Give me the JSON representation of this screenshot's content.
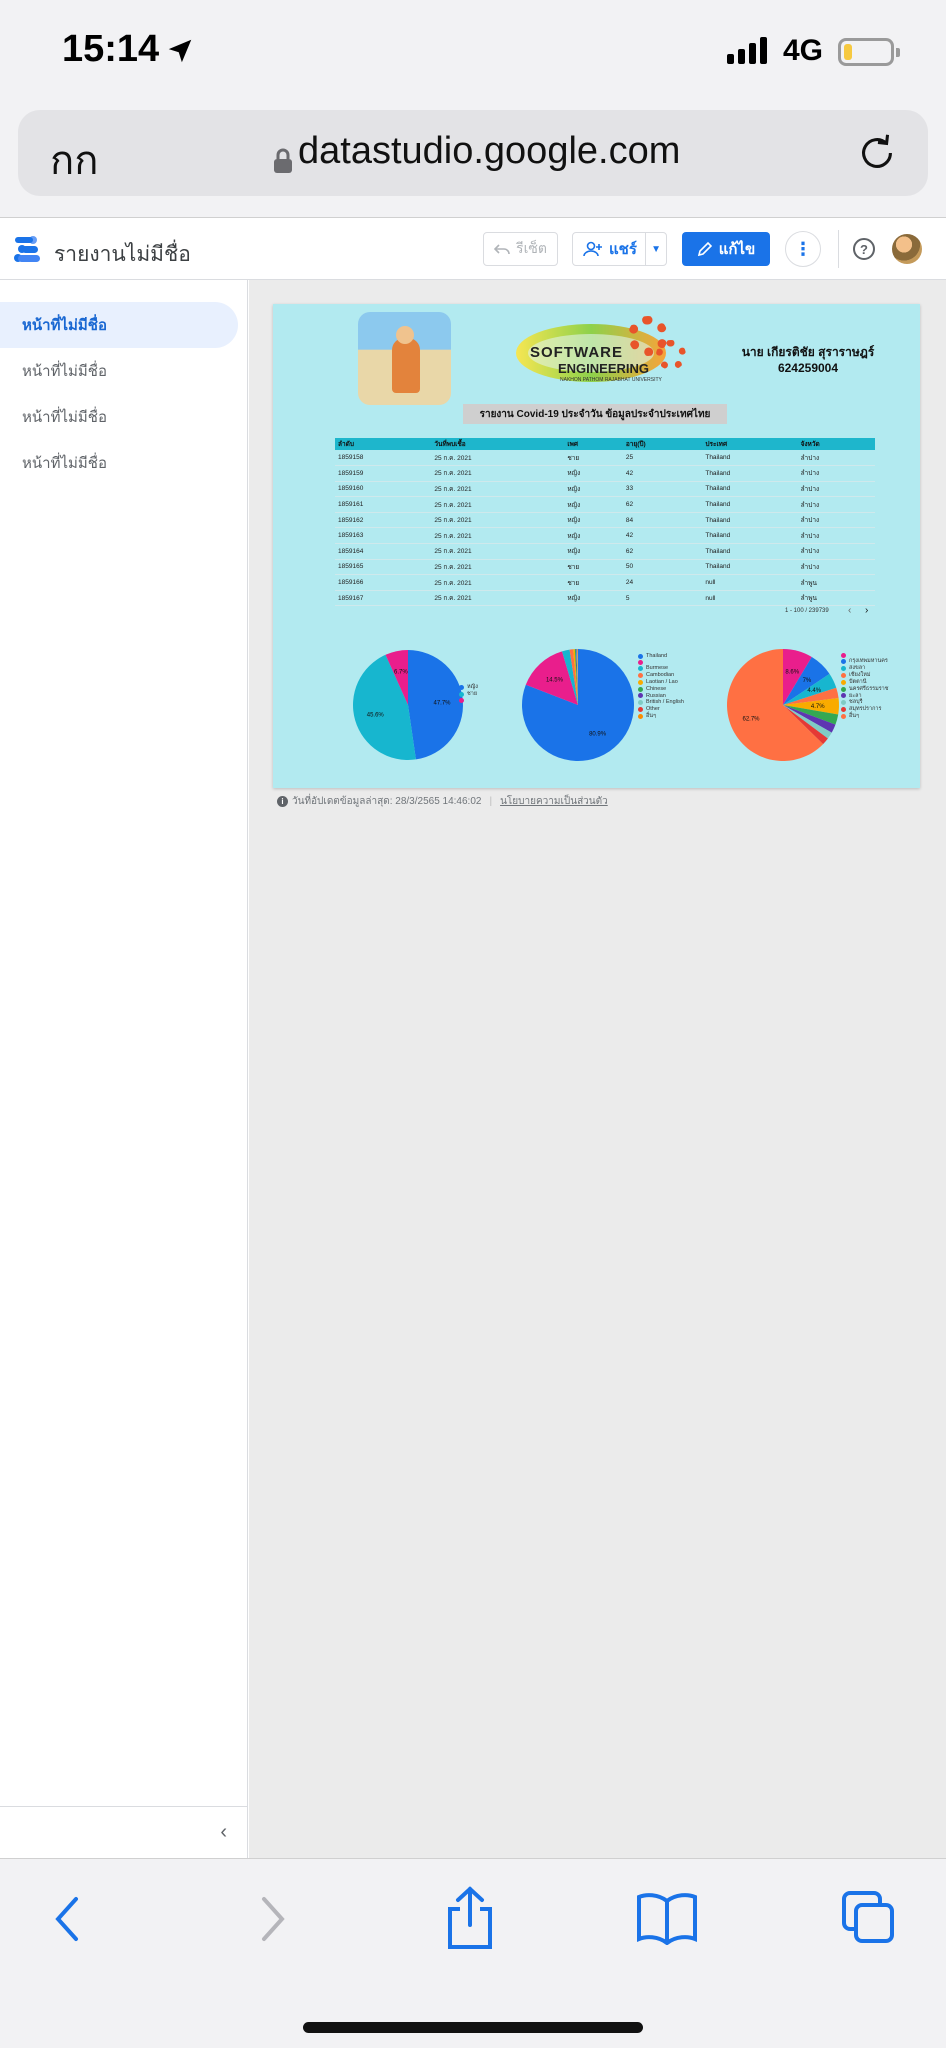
{
  "status_bar": {
    "time": "15:14",
    "network": "4G",
    "battery_level": 0.18
  },
  "safari": {
    "aa_label": "กก",
    "url": "datastudio.google.com"
  },
  "header": {
    "report_title": "รายงานไม่มีชื่อ",
    "reset_label": "รีเซ็ต",
    "share_label": "แชร์",
    "edit_label": "แก้ไข"
  },
  "sidebar": {
    "pages": [
      {
        "label": "หน้าที่ไม่มีชื่อ",
        "active": true
      },
      {
        "label": "หน้าที่ไม่มีชื่อ",
        "active": false
      },
      {
        "label": "หน้าที่ไม่มีชื่อ",
        "active": false
      },
      {
        "label": "หน้าที่ไม่มีชื่อ",
        "active": false
      }
    ]
  },
  "report": {
    "logo_line1": "SOFTWARE",
    "logo_line2": "ENGINEERING",
    "logo_line3": "NAKHON PATHOM RAJABHAT UNIVERSITY",
    "author_name": "นาย เกียรติชัย สุราราษฎร์",
    "author_id": "624259004",
    "title": "รายงาน Covid-19 ประจำวัน ข้อมูลประจำประเทศไทย",
    "table": {
      "columns": [
        "ลำดับ",
        "วันที่พบเชื้อ",
        "เพศ",
        "อายุ(ปี)",
        "ประเทศ",
        "จังหวัด"
      ],
      "rows": [
        [
          "1859158",
          "25 ก.ค. 2021",
          "ชาย",
          "25",
          "Thailand",
          "ลำปาง"
        ],
        [
          "1859159",
          "25 ก.ค. 2021",
          "หญิง",
          "42",
          "Thailand",
          "ลำปาง"
        ],
        [
          "1859160",
          "25 ก.ค. 2021",
          "หญิง",
          "33",
          "Thailand",
          "ลำปาง"
        ],
        [
          "1859161",
          "25 ก.ค. 2021",
          "หญิง",
          "62",
          "Thailand",
          "ลำปาง"
        ],
        [
          "1859162",
          "25 ก.ค. 2021",
          "หญิง",
          "84",
          "Thailand",
          "ลำปาง"
        ],
        [
          "1859163",
          "25 ก.ค. 2021",
          "หญิง",
          "42",
          "Thailand",
          "ลำปาง"
        ],
        [
          "1859164",
          "25 ก.ค. 2021",
          "หญิง",
          "62",
          "Thailand",
          "ลำปาง"
        ],
        [
          "1859165",
          "25 ก.ค. 2021",
          "ชาย",
          "50",
          "Thailand",
          "ลำปาง"
        ],
        [
          "1859166",
          "25 ก.ค. 2021",
          "ชาย",
          "24",
          "null",
          "ลำพูน"
        ],
        [
          "1859167",
          "25 ก.ค. 2021",
          "หญิง",
          "5",
          "null",
          "ลำพูน"
        ]
      ],
      "pager": "1 - 100 / 239739"
    }
  },
  "chart_data": [
    {
      "type": "pie",
      "slices": [
        {
          "label": "หญิง",
          "value": 47.7,
          "color": "#1a73e8"
        },
        {
          "label": "ชาย",
          "value": 45.6,
          "color": "#17b6cf"
        },
        {
          "label": "",
          "value": 6.7,
          "color": "#e91e8c"
        }
      ],
      "data_labels": [
        "6.7%",
        "47.7%",
        "45.6%"
      ]
    },
    {
      "type": "pie",
      "slices": [
        {
          "label": "Thailand",
          "value": 80.9,
          "color": "#1a73e8"
        },
        {
          "label": "",
          "value": 14.5,
          "color": "#e91e8c"
        },
        {
          "label": "Burmese",
          "value": 2.2,
          "color": "#17b6cf"
        },
        {
          "label": "Cambodian",
          "value": 1.0,
          "color": "#ff7043"
        },
        {
          "label": "Laotian / Lao",
          "value": 0.5,
          "color": "#f9ab00"
        },
        {
          "label": "Chinese",
          "value": 0.3,
          "color": "#34a853"
        },
        {
          "label": "Russian",
          "value": 0.2,
          "color": "#5e35b1"
        },
        {
          "label": "British / English",
          "value": 0.2,
          "color": "#80cbc4"
        },
        {
          "label": "Other",
          "value": 0.1,
          "color": "#e53935"
        },
        {
          "label": "อื่นๆ",
          "value": 0.1,
          "color": "#fb8c00"
        }
      ],
      "data_labels": [
        "14.5%",
        "80.9%"
      ]
    },
    {
      "type": "pie",
      "slices": [
        {
          "label": "",
          "value": 8.6,
          "color": "#e91e8c"
        },
        {
          "label": "กรุงเทพมหานคร",
          "value": 7.0,
          "color": "#1a73e8"
        },
        {
          "label": "สงขลา",
          "value": 4.4,
          "color": "#17b6cf"
        },
        {
          "label": "เชียงใหม่",
          "value": 3.0,
          "color": "#ff7043"
        },
        {
          "label": "ปัตตานี",
          "value": 4.7,
          "color": "#f9ab00"
        },
        {
          "label": "นครศรีธรรมราช",
          "value": 3.0,
          "color": "#34a853"
        },
        {
          "label": "ยะลา",
          "value": 2.5,
          "color": "#5e35b1"
        },
        {
          "label": "ชลบุรี",
          "value": 2.0,
          "color": "#80cbc4"
        },
        {
          "label": "สมุทรปราการ",
          "value": 2.1,
          "color": "#e53935"
        },
        {
          "label": "อื่นๆ",
          "value": 62.7,
          "color": "#ff7043"
        }
      ],
      "data_labels": [
        "8.6%",
        "7%",
        "4.4%",
        "4.7%",
        "62.7%"
      ]
    }
  ],
  "footer": {
    "updated": "วันที่อัปเดตข้อมูลล่าสุด: 28/3/2565 14:46:02",
    "privacy": "นโยบายความเป็นส่วนตัว"
  }
}
